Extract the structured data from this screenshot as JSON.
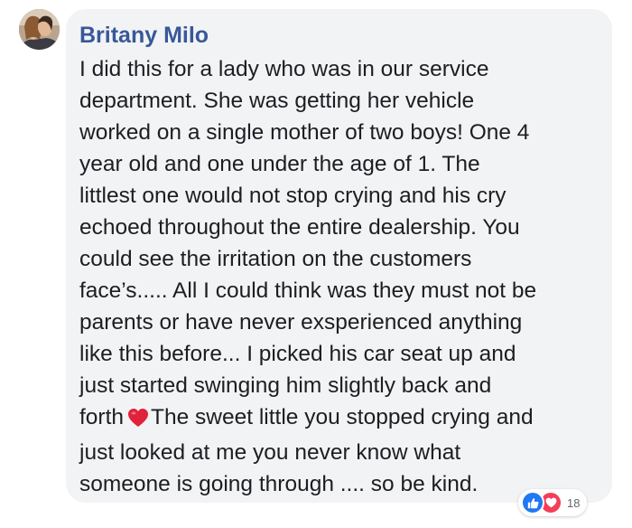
{
  "comment": {
    "author": "Britany Milo",
    "lines": [
      "I did this for a lady who was in our service",
      "department. She was getting her vehicle",
      "worked on a single mother of two boys! One 4",
      "year old and one under the age of 1. The",
      "littlest one would not stop crying and his cry",
      "echoed throughout the entire dealership. You",
      "could see the irritation on the customers",
      "face’s..... All I could think was they must not be",
      "parents or have never exsperienced anything",
      "like this before... I picked his car seat up and",
      "just started swinging him slightly back and"
    ],
    "line12_before": "forth",
    "line12_after": "The sweet little you stopped crying and",
    "lines_end": [
      "just looked at me you never know what",
      "someone is going through .... so be kind."
    ],
    "inline_emoji": "heart-icon",
    "reactions": {
      "types": [
        "like",
        "love"
      ],
      "count": "18"
    }
  },
  "colors": {
    "author": "#385898",
    "bubble": "#f2f3f5",
    "text": "#1c1e21",
    "like": "#2078f4",
    "love": "#f33e58"
  }
}
